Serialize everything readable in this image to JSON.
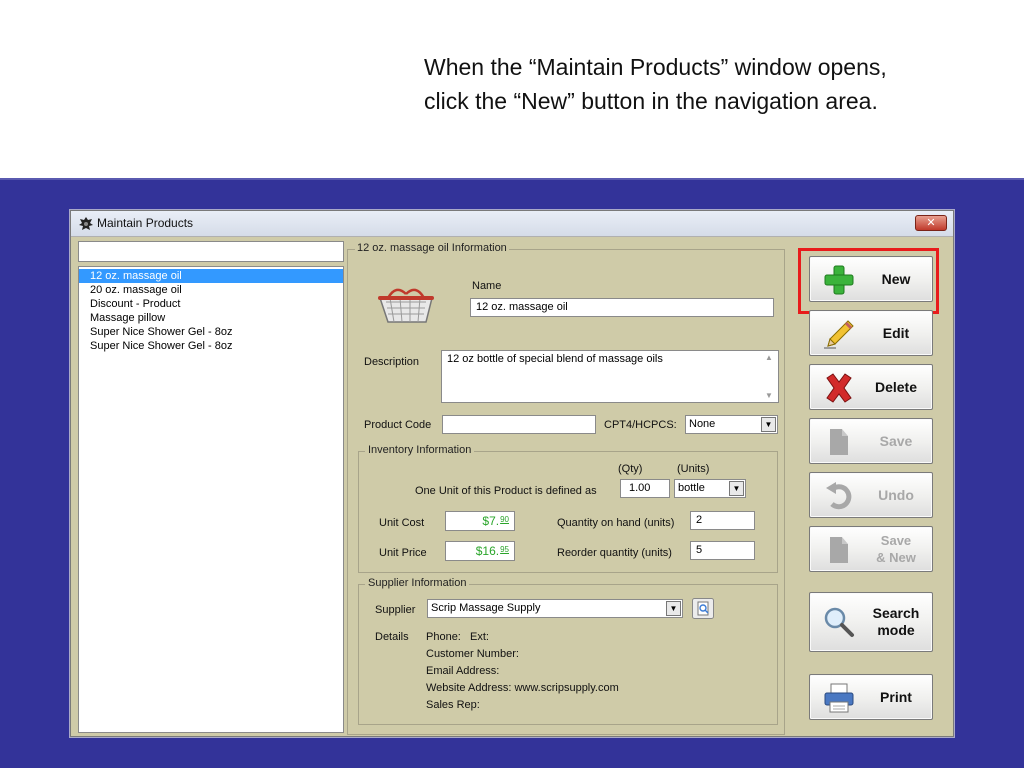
{
  "caption": {
    "line1": "When the “Maintain Products” window opens,",
    "line2": "click the “New” button in the navigation area."
  },
  "window": {
    "title": "Maintain Products",
    "close_label": "✕"
  },
  "product_list": {
    "search_value": "",
    "items": [
      "12 oz. massage oil",
      "20 oz. massage oil",
      "Discount - Product",
      "Massage pillow",
      "Super Nice Shower Gel - 8oz",
      "Super Nice Shower Gel - 8oz"
    ],
    "selected_index": 0
  },
  "info": {
    "group_label": "12 oz. massage oil Information",
    "name_label": "Name",
    "name_value": "12 oz. massage oil",
    "description_label": "Description",
    "description_value": "12 oz bottle of special blend of massage oils",
    "product_code_label": "Product Code",
    "product_code_value": "",
    "cpt_label": "CPT4/HCPCS:",
    "cpt_value": "None"
  },
  "inventory": {
    "group_label": "Inventory Information",
    "qty_header": "(Qty)",
    "units_header": "(Units)",
    "unit_defined_label": "One Unit of this Product is defined as",
    "qty_value": "1.00",
    "units_value": "bottle",
    "unit_cost_label": "Unit Cost",
    "unit_cost_dollars": "$7.",
    "unit_cost_cents": "90",
    "unit_price_label": "Unit Price",
    "unit_price_dollars": "$16.",
    "unit_price_cents": "95",
    "on_hand_label": "Quantity on hand (units)",
    "on_hand_value": "2",
    "reorder_label": "Reorder quantity (units)",
    "reorder_value": "5"
  },
  "supplier": {
    "group_label": "Supplier Information",
    "supplier_label": "Supplier",
    "supplier_value": "Scrip Massage Supply",
    "details_label": "Details",
    "phone": "Phone:   Ext:",
    "customer_number": "Customer Number:",
    "email": "Email Address:",
    "website": "Website Address: www.scripsupply.com",
    "sales_rep": "Sales Rep:"
  },
  "nav": {
    "new_label": "New",
    "edit_label": "Edit",
    "delete_label": "Delete",
    "save_label": "Save",
    "undo_label": "Undo",
    "save_new_label": "Save\n& New",
    "search_label": "Search\nmode",
    "print_label": "Print"
  },
  "colors": {
    "desktop_bg": "#333399",
    "window_bg": "#cfcba8",
    "highlight": "#e81b1b",
    "money_text": "#2aa52a",
    "selection": "#3399ff"
  }
}
